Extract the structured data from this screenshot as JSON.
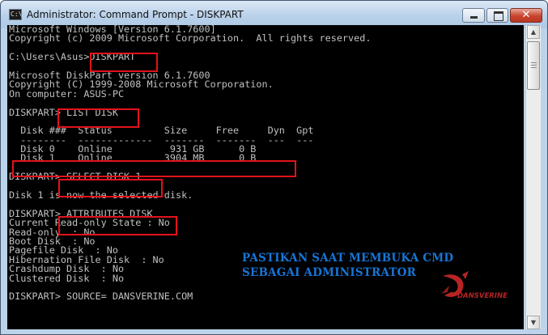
{
  "window": {
    "title": "Administrator: Command Prompt - DISKPART",
    "icon": "cmd-icon",
    "controls": [
      "minimize-icon",
      "maximize-icon",
      "close-icon"
    ],
    "close_glyph": "✕"
  },
  "console": {
    "lines": [
      "Microsoft Windows [Version 6.1.7600]",
      "Copyright (c) 2009 Microsoft Corporation.  All rights reserved.",
      "",
      "C:\\Users\\Asus>DISKPART",
      "",
      "Microsoft DiskPart version 6.1.7600",
      "Copyright (C) 1999-2008 Microsoft Corporation.",
      "On computer: ASUS-PC",
      "",
      "DISKPART> LIST DISK",
      "",
      "  Disk ###  Status         Size     Free     Dyn  Gpt",
      "  --------  -------------  -------  -------  ---  ---",
      "  Disk 0    Online          931 GB      0 B",
      "  Disk 1    Online         3904 MB      0 B",
      "",
      "DISKPART> SELECT DISK 1",
      "",
      "Disk 1 is now the selected disk.",
      "",
      "DISKPART> ATTRIBUTES DISK",
      "Current Read-only State : No",
      "Read-only  : No",
      "Boot Disk  : No",
      "Pagefile Disk  : No",
      "Hibernation File Disk  : No",
      "Crashdump Disk  : No",
      "Clustered Disk  : No",
      "",
      "DISKPART> SOURCE= DANSVERINE.COM"
    ]
  },
  "overlay": {
    "line1": "PASTIKAN SAAT MEMBUKA CMD",
    "line2": "SEBAGAI ADMINISTRATOR",
    "color": "#1775d6"
  },
  "watermark": {
    "text": "DANSVERINE",
    "color": "#b72424"
  },
  "highlight_color": "#e3121b",
  "scrollbar": {
    "up_glyph": "▲",
    "down_glyph": "▼"
  }
}
